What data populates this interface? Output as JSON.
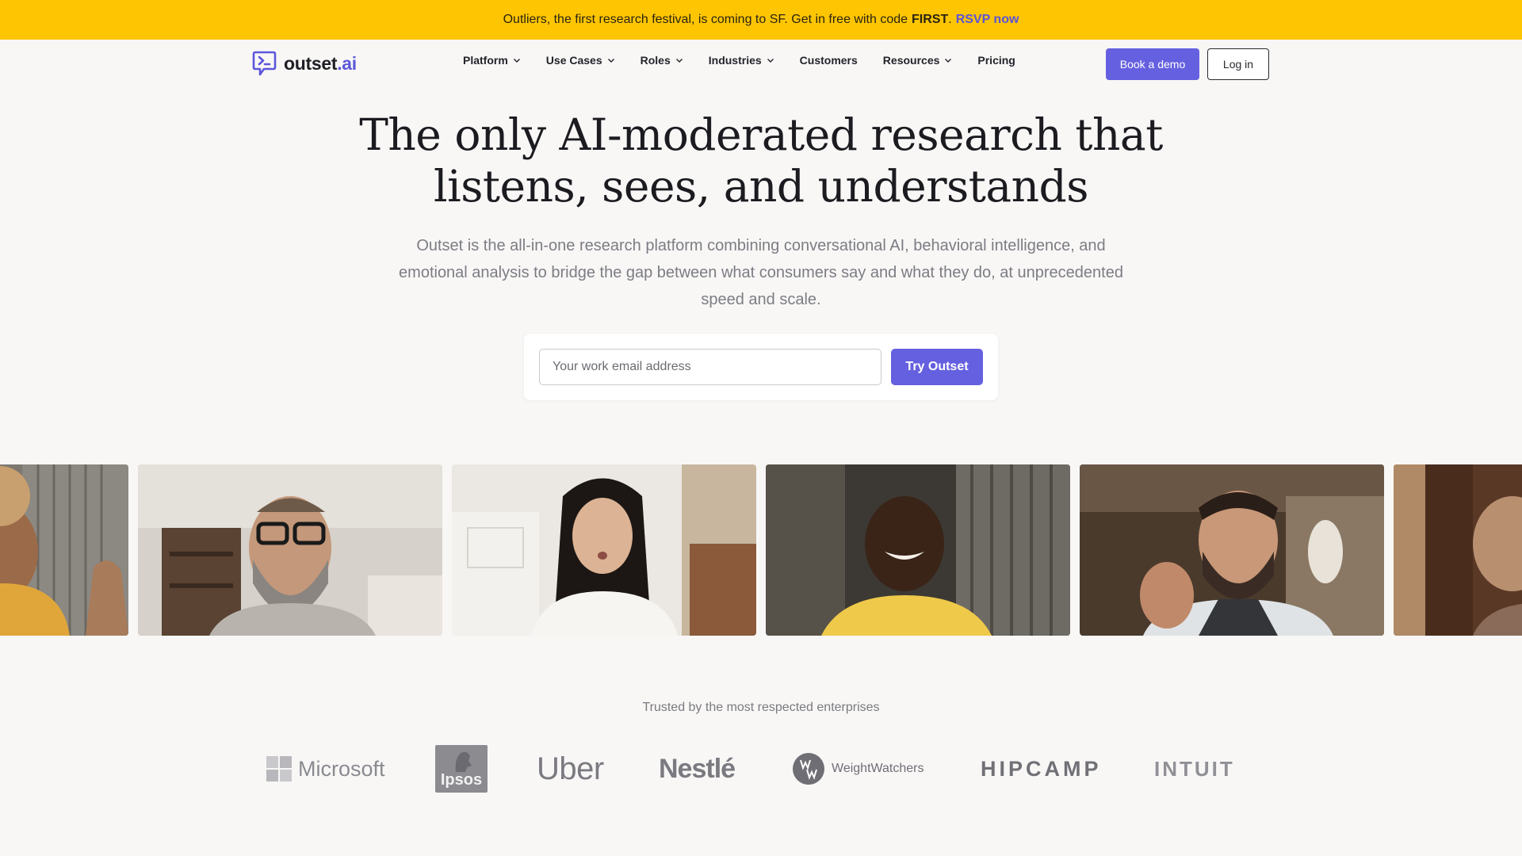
{
  "announcement": {
    "text": "Outliers, the first research festival, is coming to SF. Get in free with code",
    "code": "FIRST",
    "dot": ".",
    "link": "RSVP now"
  },
  "brand": {
    "name_main": "outset",
    "name_suffix": ".ai",
    "accent": "#5d57db"
  },
  "nav": {
    "items": [
      {
        "label": "Platform",
        "dropdown": true
      },
      {
        "label": "Use Cases",
        "dropdown": true
      },
      {
        "label": "Roles",
        "dropdown": true
      },
      {
        "label": "Industries",
        "dropdown": true
      },
      {
        "label": "Customers",
        "dropdown": false
      },
      {
        "label": "Resources",
        "dropdown": true
      },
      {
        "label": "Pricing",
        "dropdown": false
      }
    ],
    "demo_label": "Book a demo",
    "login_label": "Log in"
  },
  "hero": {
    "title_line1": "The only AI-moderated research that",
    "title_line2": "listens, sees, and understands",
    "subtitle": "Outset is the all-in-one research platform combining conversational AI, behavioral intelligence, and emotional analysis to bridge the gap between what consumers say and what they do, at unprecedented speed and scale.",
    "email_placeholder": "Your work email address",
    "cta_label": "Try Outset"
  },
  "tiles": [
    {
      "name": "participant-video-1"
    },
    {
      "name": "participant-video-2"
    },
    {
      "name": "participant-video-3"
    },
    {
      "name": "participant-video-4"
    },
    {
      "name": "participant-video-5"
    },
    {
      "name": "participant-video-6"
    }
  ],
  "trusted": {
    "heading": "Trusted by the most respected enterprises",
    "logos": [
      "Microsoft",
      "Ipsos",
      "Uber",
      "Nestlé",
      "WeightWatchers",
      "HIPCAMP",
      "INTUIT"
    ]
  },
  "colors": {
    "banner": "#fec502",
    "primary_button": "#6560e0",
    "background": "#f8f7f6"
  }
}
